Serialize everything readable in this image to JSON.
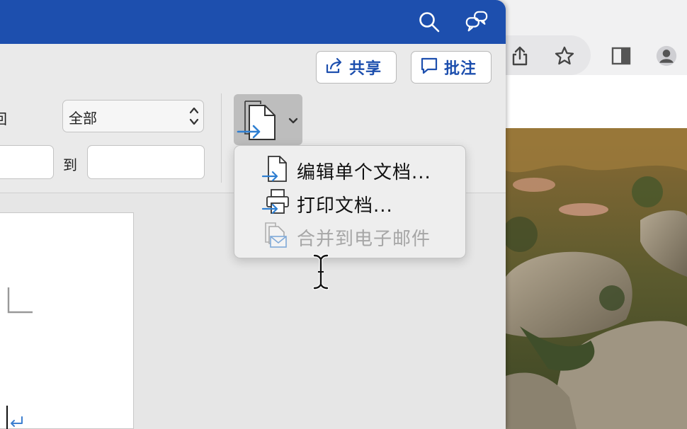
{
  "word": {
    "titlebar": {
      "search_icon": "search-icon",
      "assistant_icon": "chat-bubbles-icon"
    },
    "ribbon": {
      "share_label": "共享",
      "comment_label": "批注",
      "partial_label": "回",
      "select_value": "全部",
      "to_label": "到"
    },
    "merge_menu": {
      "items": [
        {
          "label": "编辑单个文档...",
          "icon": "document-arrow-icon",
          "enabled": true
        },
        {
          "label": "打印文档...",
          "icon": "printer-arrow-icon",
          "enabled": true
        },
        {
          "label": "合并到电子邮件",
          "icon": "document-mail-icon",
          "enabled": false
        }
      ]
    },
    "colors": {
      "titlebar": "#1d4fae",
      "accent_text": "#1d4fae",
      "arrow_blue": "#2f7fd1"
    }
  },
  "browser": {
    "toolbar_icons": [
      "share-icon",
      "bookmark-star-icon",
      "sidebar-icon",
      "profile-icon"
    ]
  }
}
